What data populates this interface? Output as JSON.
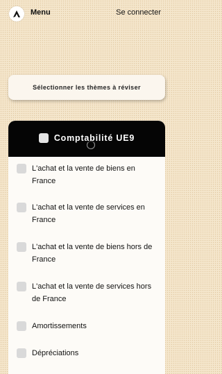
{
  "header": {
    "menu_label": "Menu",
    "login_label": "Se connecter"
  },
  "theme_button": {
    "label": "Sélectionner les thèmes à réviser"
  },
  "panel": {
    "title": "Comptabilité UE9",
    "items": [
      {
        "label": "L'achat et la vente de biens en France"
      },
      {
        "label": "L'achat et la vente de services en France"
      },
      {
        "label": "L'achat et la vente de biens hors de France"
      },
      {
        "label": "L'achat et la vente de services hors de France"
      },
      {
        "label": "Amortissements"
      },
      {
        "label": "Dépréciations"
      }
    ]
  },
  "colors": {
    "background": "#f3e3c7",
    "header_bg": "#050505",
    "panel_bg": "#fdfbf7"
  }
}
